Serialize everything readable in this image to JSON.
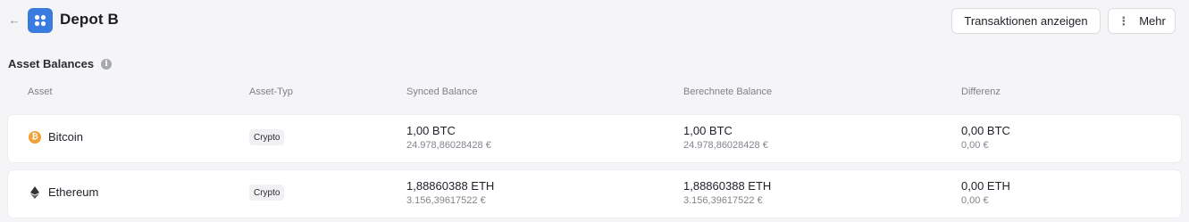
{
  "header": {
    "back_label": "←",
    "title": "Depot B",
    "transactions_button": "Transaktionen anzeigen",
    "more_button": "Mehr",
    "more_dots": "⋮",
    "app_icon_color": "#3a7be0"
  },
  "section": {
    "title": "Asset Balances",
    "info_symbol": "i"
  },
  "table": {
    "columns": [
      "Asset",
      "Asset-Typ",
      "Synced Balance",
      "Berechnete Balance",
      "Differenz"
    ],
    "rows": [
      {
        "asset": "Bitcoin",
        "icon": "bitcoin-icon",
        "icon_glyph": "₿",
        "icon_color": "#f2a033",
        "type": "Crypto",
        "synced_main": "1,00 BTC",
        "synced_sub": "24.978,86028428 €",
        "calc_main": "1,00 BTC",
        "calc_sub": "24.978,86028428 €",
        "diff_main": "0,00 BTC",
        "diff_sub": "0,00 €"
      },
      {
        "asset": "Ethereum",
        "icon": "ethereum-icon",
        "icon_color": "#3c3c3d",
        "type": "Crypto",
        "synced_main": "1,88860388 ETH",
        "synced_sub": "3.156,39617522 €",
        "calc_main": "1,88860388 ETH",
        "calc_sub": "3.156,39617522 €",
        "diff_main": "0,00 ETH",
        "diff_sub": "0,00 €"
      }
    ]
  }
}
